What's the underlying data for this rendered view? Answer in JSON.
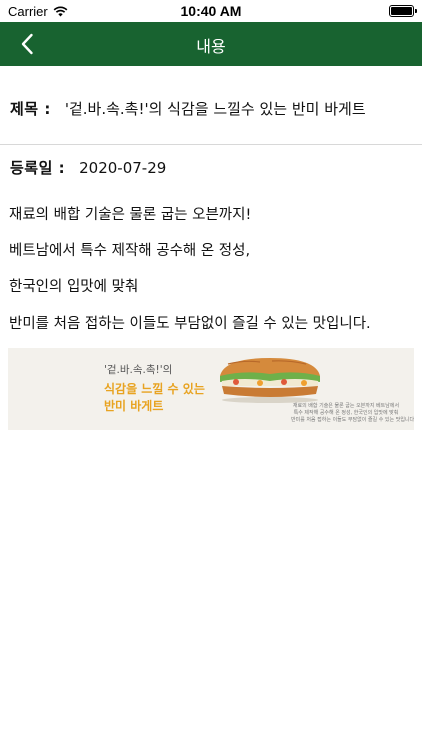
{
  "status_bar": {
    "carrier": "Carrier",
    "time": "10:40 AM"
  },
  "nav": {
    "title": "내용",
    "back_icon": "chevron-left-icon"
  },
  "post": {
    "title_label": "제목 :",
    "title_value": "'겉.바.속.촉!'의 식감을 느낄수 있는 반미 바게트",
    "date_label": "등록일 :",
    "date_value": "2020-07-29",
    "body_lines": [
      "재료의 배합 기술은 물론 굽는 오븐까지!",
      "베트남에서 특수 제작해 공수해 온 정성,",
      "한국인의 입맛에 맞춰",
      "반미를 처음 접하는 이들도 부담없이 즐길 수 있는 맛입니다."
    ]
  },
  "banner": {
    "quote": "'겉.바.속.촉!'의",
    "headline_1": "식감을 느낄 수 있는",
    "headline_2": "반미 바게트",
    "small_text": [
      "재료의 배합 기술은 물론 굽는 오븐까지 베트남에서",
      "특수 제작해 공수해 온 정성, 한국인의 입맛에 맞춰",
      "반미를 처음 접하는 이들도 부담없이 즐길 수 있는 맛입니다."
    ],
    "image": "banh-mi-sandwich"
  },
  "colors": {
    "nav_bg": "#186330",
    "banner_bg": "#f3f1ec",
    "accent": "#e8a321"
  }
}
